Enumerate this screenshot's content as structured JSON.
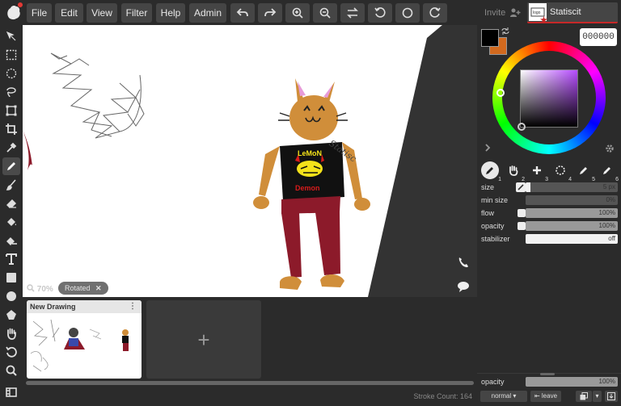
{
  "menu": {
    "file": "File",
    "edit": "Edit",
    "view": "View",
    "filter": "Filter",
    "help": "Help",
    "admin": "Admin"
  },
  "toolbar_icons": [
    "move-icon",
    "select-rect-icon",
    "select-ellipse-icon",
    "lasso-icon",
    "transform-icon",
    "crop-icon",
    "eyedropper-icon",
    "pen-icon",
    "brush-icon",
    "eraser-icon",
    "fill-icon",
    "gradient-icon",
    "text-icon",
    "rectangle-icon",
    "ellipse-icon",
    "shape-icon",
    "hand-icon",
    "rotate-icon",
    "zoom-icon",
    "frames-icon"
  ],
  "canvas": {
    "zoom": "70%",
    "rotation_tag": "Rotated",
    "signature_text": "Statisc",
    "shirt_top": "LeMoN",
    "shirt_bottom": "Demon"
  },
  "files": {
    "card_title": "New Drawing",
    "add_symbol": "+"
  },
  "status": {
    "stroke_count": "Stroke Count: 164"
  },
  "panel": {
    "invite": "Invite",
    "username": "Statiscit",
    "hex": "000000",
    "primary_color": "#000000",
    "secondary_color": "#d2691e",
    "accent": "#c62828",
    "brushes": [
      "1",
      "2",
      "3",
      "4",
      "5",
      "6"
    ],
    "settings": [
      {
        "label": "size",
        "value": "5 px",
        "fill": 0.05
      },
      {
        "label": "min size",
        "value": "0%",
        "fill": 0.0
      },
      {
        "label": "flow",
        "value": "100%",
        "fill": 1.0
      },
      {
        "label": "opacity",
        "value": "100%",
        "fill": 1.0
      },
      {
        "label": "stabilizer",
        "value": "off",
        "fill": 1.0
      }
    ],
    "layer_opacity_label": "opacity",
    "layer_opacity_value": "100%",
    "blend_mode": "normal",
    "leave": "leave"
  }
}
